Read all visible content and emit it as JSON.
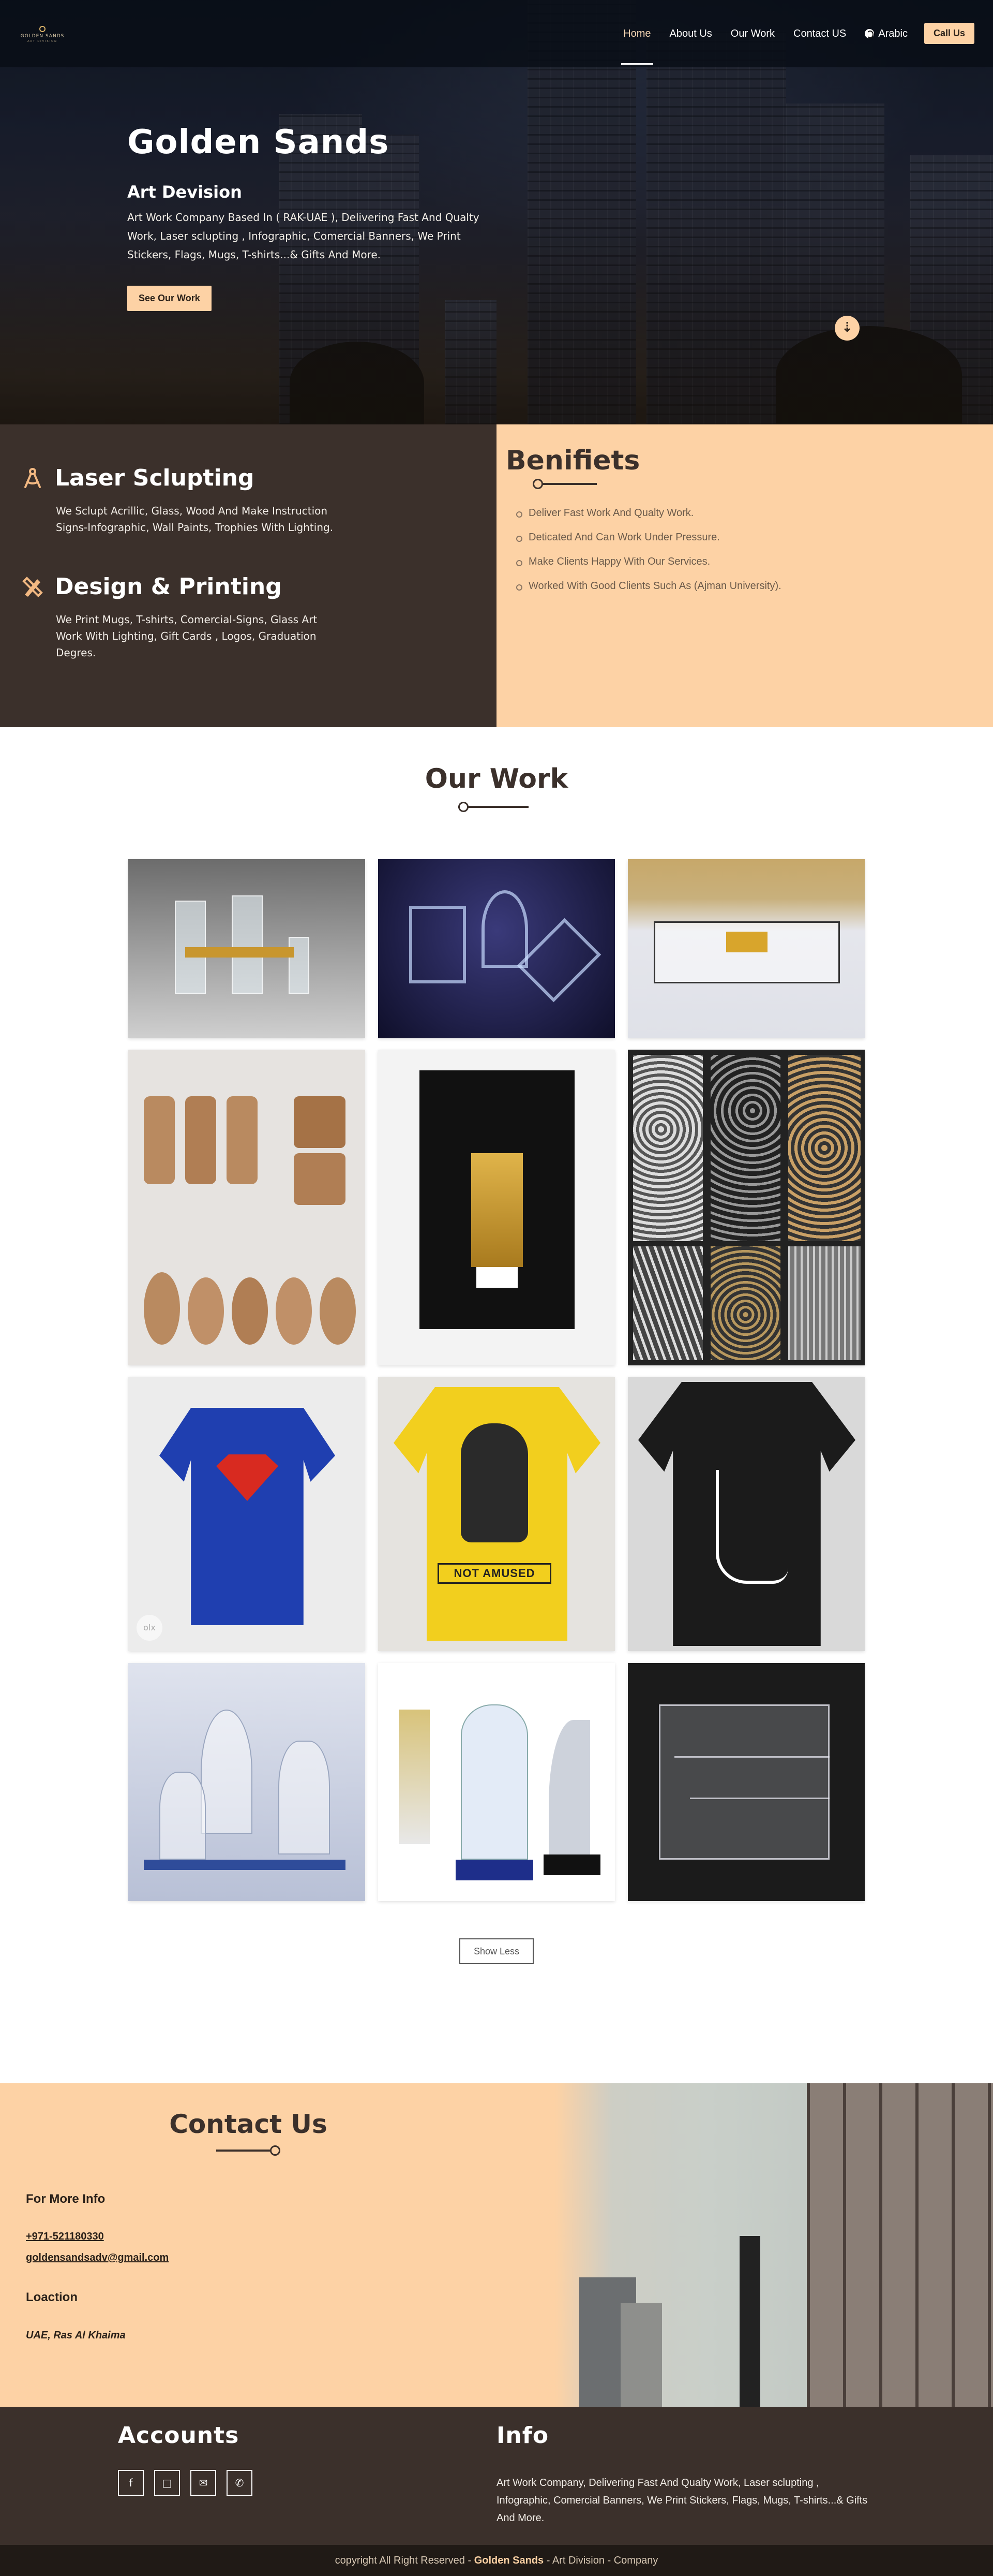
{
  "nav": {
    "logo_text": "GOLDEN SANDS",
    "logo_sub": "ART DIVISION",
    "links": [
      "Home",
      "About Us",
      "Our Work",
      "Contact US"
    ],
    "arabic": "Arabic",
    "call": "Call Us"
  },
  "hero": {
    "title": "Golden Sands",
    "subtitle": "Art Devision",
    "description": "Art Work Company Based In ( RAK-UAE ), Delivering Fast And Qualty Work, Laser sclupting , Infographic, Comercial Banners, We Print Stickers, Flags, Mugs, T-shirts...& Gifts And More.",
    "button": "See Our Work"
  },
  "services": [
    {
      "title": "Laser Sclupting",
      "icon": "compass-icon",
      "description": "We Sclupt Acrillic, Glass, Wood And Make Instruction Signs-Infographic, Wall Paints, Trophies With Lighting."
    },
    {
      "title": "Design & Printing",
      "icon": "pencil-ruler-icon",
      "description": "We Print Mugs, T-shirts, Comercial-Signs, Glass Art Work With Lighting, Gift Cards , Logos, Graduation Degres."
    }
  ],
  "benefits": {
    "title": "Benifiets",
    "items": [
      "Deliver Fast Work And Qualty Work.",
      "Deticated And Can Work Under Pressure.",
      "Make Clients Happy With Our Services.",
      "Worked With Good Clients Such As (Ajman University)."
    ]
  },
  "work": {
    "title": "Our Work",
    "gallery_text": {
      "tshirt_1": "NOT AMUSED",
      "watermark": "olx"
    },
    "show_less": "Show Less"
  },
  "contact": {
    "title": "Contact Us",
    "more_info": "For More Info",
    "phone": "+971-521180330",
    "email": "goldensandsadv@gmail.com",
    "location_heading": "Loaction",
    "location": "UAE, Ras Al Khaima"
  },
  "footer": {
    "accounts": "Accounts",
    "info": "Info",
    "info_text": "Art Work Company, Delivering Fast And Qualty Work, Laser sclupting , Infographic, Comercial Banners, We Print Stickers, Flags, Mugs, T-shirts...& Gifts And More.",
    "copyright_prefix": "copyright All Right Reserved - ",
    "copyright_brand": "Golden Sands",
    "copyright_suffix": " - Art Division - Company",
    "social_icons": [
      "facebook-icon",
      "instagram-icon",
      "email-icon",
      "phone-icon"
    ]
  },
  "colors": {
    "accent": "#fdd2a5",
    "dark": "#3b302b"
  }
}
